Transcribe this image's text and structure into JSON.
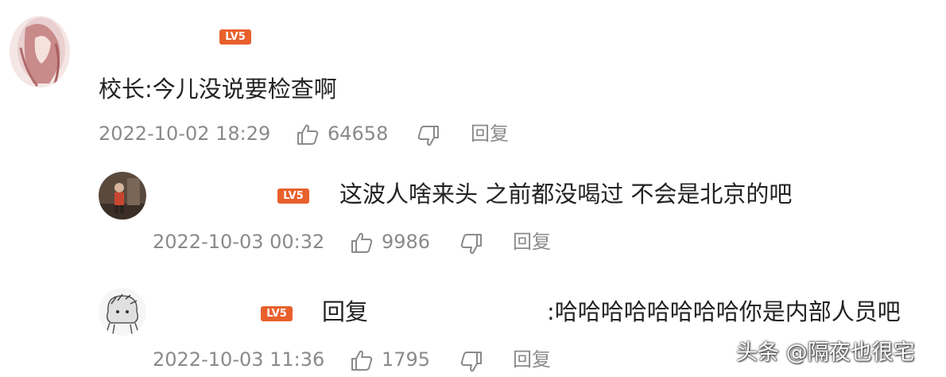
{
  "comments": [
    {
      "level_badge": "LV5",
      "text": "校长:今儿没说要检查啊",
      "timestamp": "2022-10-02 18:29",
      "like_count": "64658",
      "reply_label": "回复"
    },
    {
      "level_badge": "LV5",
      "text": "这波人啥来头 之前都没喝过 不会是北京的吧",
      "timestamp": "2022-10-03 00:32",
      "like_count": "9986",
      "reply_label": "回复"
    },
    {
      "level_badge": "LV5",
      "reply_prefix": "回复",
      "text": ":哈哈哈哈哈哈哈哈你是内部人员吧",
      "timestamp": "2022-10-03 11:36",
      "like_count": "1795",
      "reply_label": "回复"
    }
  ],
  "watermark": "头条 @隔夜也很宅",
  "icons": {
    "like": "thumbs-up-icon",
    "dislike": "thumbs-down-icon"
  },
  "colors": {
    "badge": "#e8602c",
    "meta_text": "#8a8a8a",
    "body_text": "#222222"
  }
}
